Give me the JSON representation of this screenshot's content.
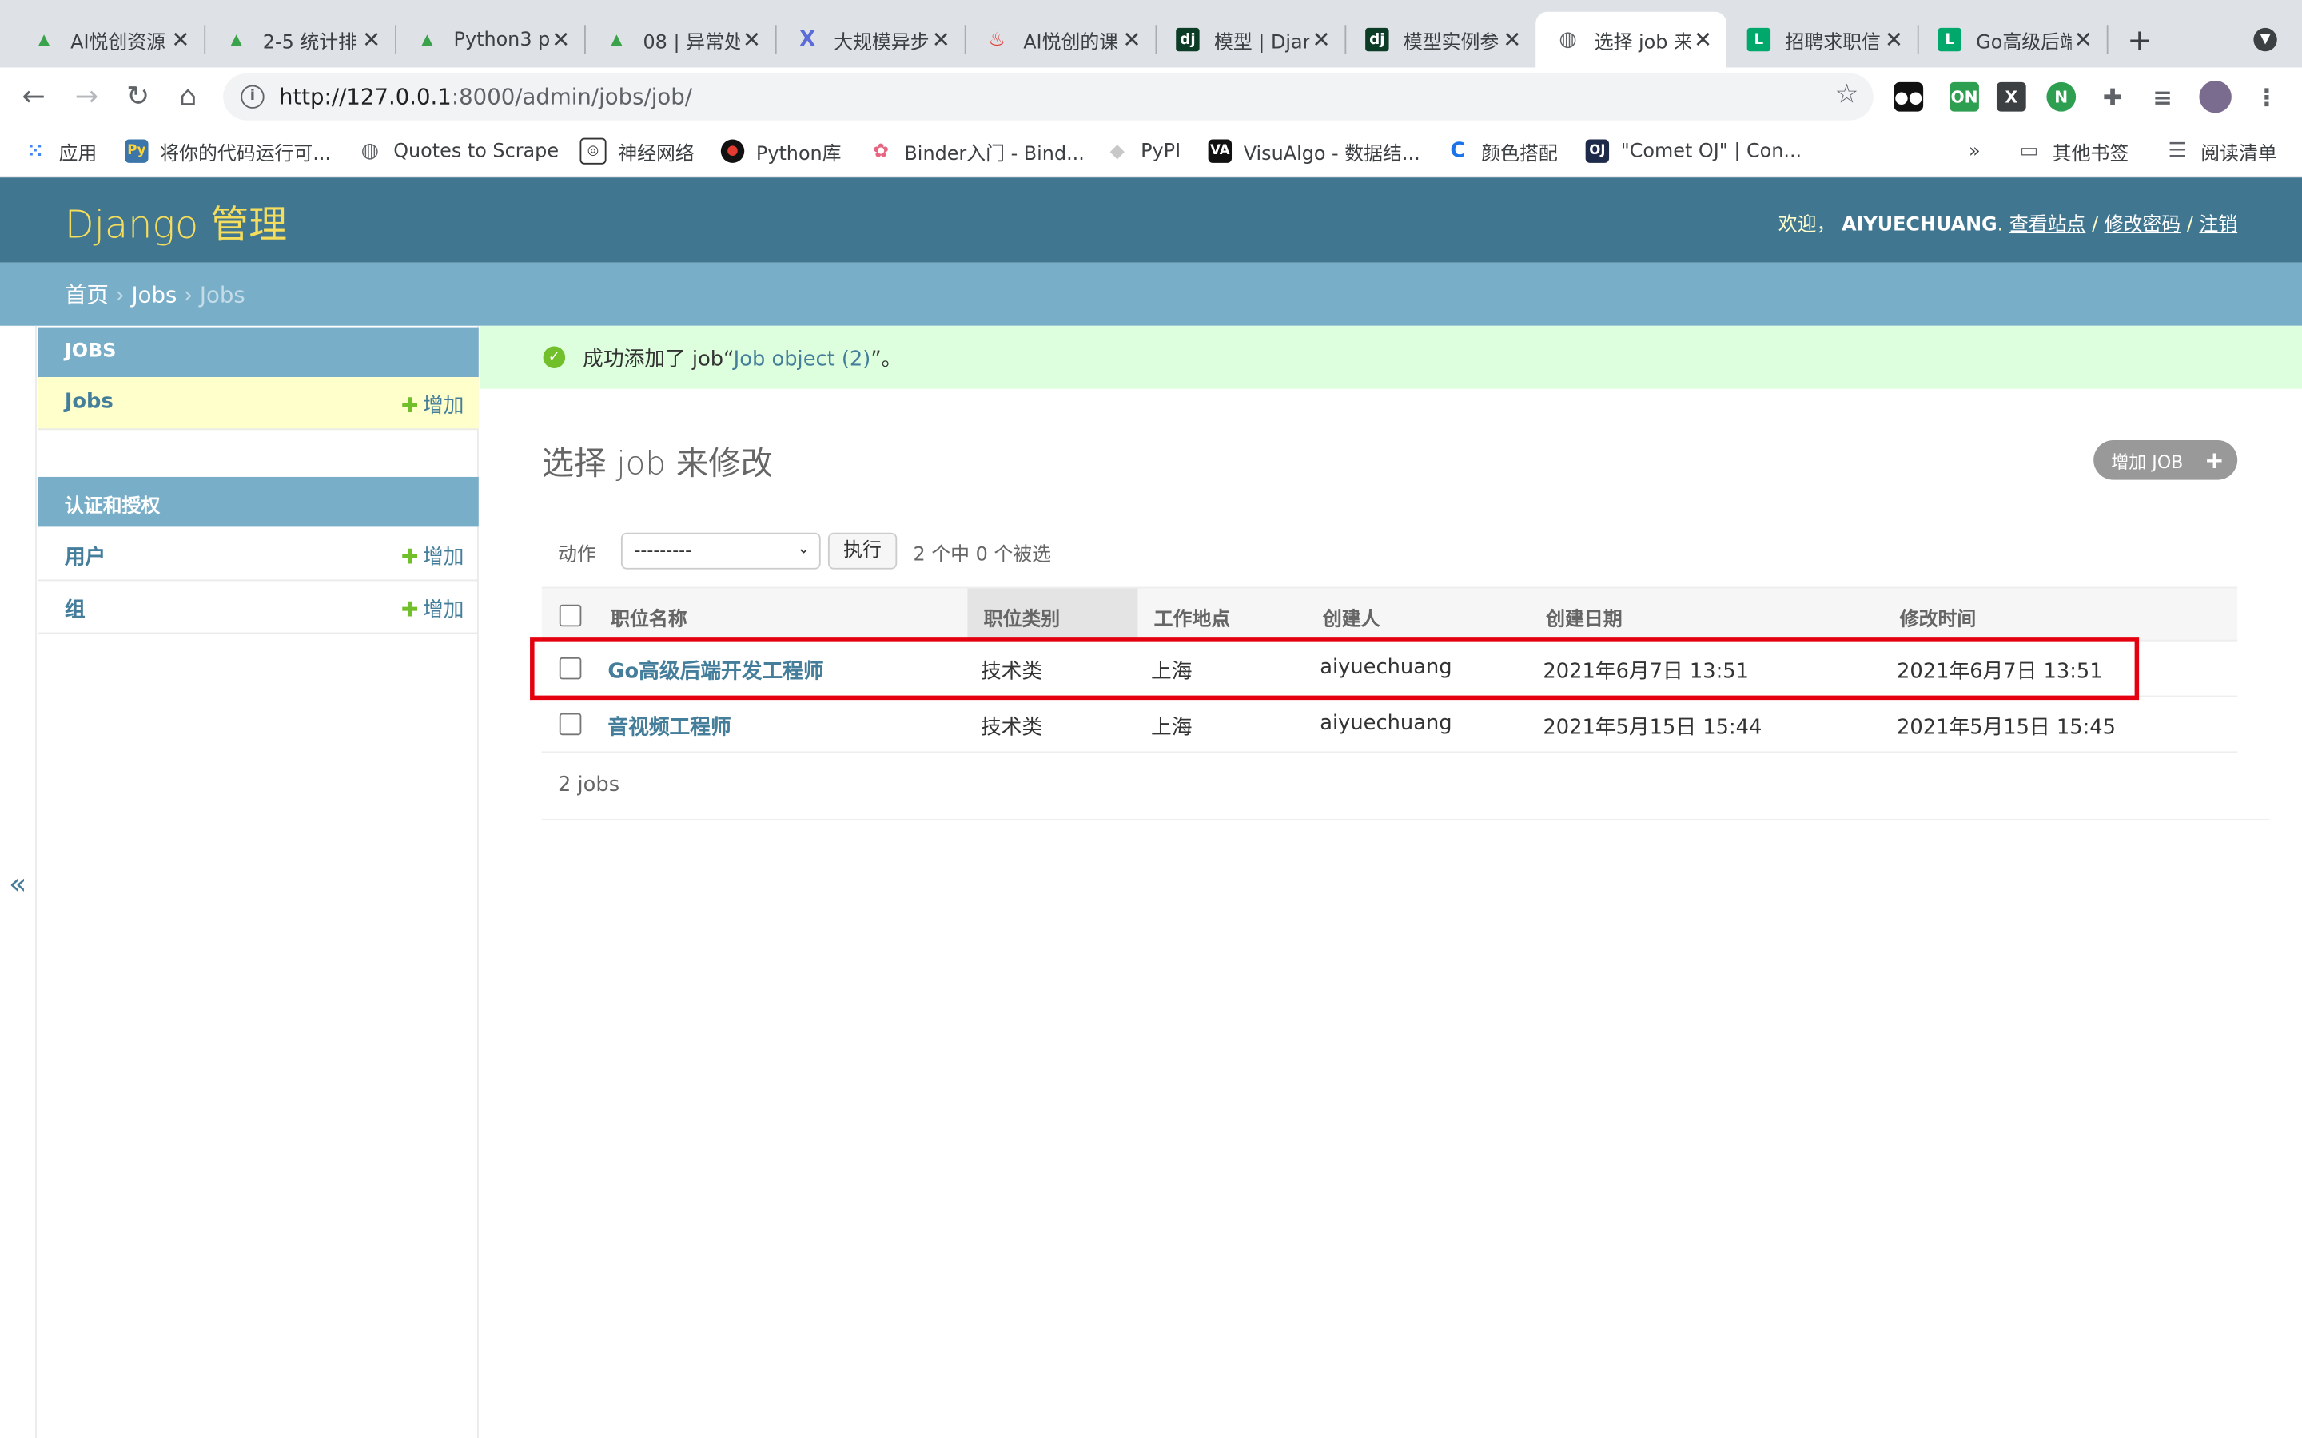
{
  "browser": {
    "tabs": [
      {
        "title": "AI悦创资源",
        "icon": "leaf-icon",
        "color": "#3aa24a"
      },
      {
        "title": "2-5 统计排",
        "icon": "leaf-icon",
        "color": "#3aa24a"
      },
      {
        "title": "Python3 p",
        "icon": "leaf-icon",
        "color": "#3aa24a"
      },
      {
        "title": "08 | 异常处",
        "icon": "leaf-icon",
        "color": "#3aa24a"
      },
      {
        "title": "大规模异步",
        "icon": "x-logo-icon",
        "color": "#5b6bd9"
      },
      {
        "title": "AI悦创的课",
        "icon": "flame-icon",
        "color": "#e23b32"
      },
      {
        "title": "模型 | Djan",
        "icon": "django-icon",
        "color": "#0c3c26"
      },
      {
        "title": "模型实例参",
        "icon": "django-icon",
        "color": "#0c3c26"
      },
      {
        "title": "选择 job 来",
        "icon": "globe-icon",
        "color": "#5f6368"
      },
      {
        "title": "招聘求职信",
        "icon": "l-logo-icon",
        "color": "#00a86b"
      },
      {
        "title": "Go高级后端",
        "icon": "l-logo-icon",
        "color": "#00a86b"
      }
    ],
    "url_host": "http://127.0.0.1",
    "url_path": ":8000/admin/jobs/job/",
    "bookmarks": [
      {
        "label": "应用",
        "icon": "apps-grid-icon"
      },
      {
        "label": "将你的代码运行可...",
        "icon": "python-icon"
      },
      {
        "label": "Quotes to Scrape",
        "icon": "globe-icon"
      },
      {
        "label": "神经网络",
        "icon": "spiral-icon"
      },
      {
        "label": "Python库",
        "icon": "red-dot-icon"
      },
      {
        "label": "Binder入门 - Bind...",
        "icon": "binder-icon"
      },
      {
        "label": "PyPI",
        "icon": "cube-icon"
      },
      {
        "label": "VisuAlgo - 数据结...",
        "icon": "va-icon"
      },
      {
        "label": "颜色搭配",
        "icon": "c-logo-icon"
      },
      {
        "label": "\"Comet OJ\" | Con...",
        "icon": "oj-icon"
      }
    ],
    "bookmarks_more": "»",
    "other_bookmarks": "其他书签",
    "reading_list": "阅读清单"
  },
  "header": {
    "branding": "Django 管理",
    "welcome": "欢迎，",
    "username": "AIYUECHUANG",
    "view_site": "查看站点",
    "change_password": "修改密码",
    "logout": "注销"
  },
  "breadcrumbs": {
    "home": "首页",
    "app": "Jobs",
    "current": "Jobs"
  },
  "sidebar": {
    "modules": [
      {
        "caption": "JOBS",
        "rows": [
          {
            "label": "Jobs",
            "add": "增加",
            "current": true
          }
        ]
      },
      {
        "caption": "认证和授权",
        "rows": [
          {
            "label": "用户",
            "add": "增加"
          },
          {
            "label": "组",
            "add": "增加"
          }
        ]
      }
    ],
    "collapse": "«"
  },
  "message": {
    "prefix": "成功添加了 job“",
    "link": "Job object (2)",
    "suffix": "”。"
  },
  "content": {
    "title": "选择 job 来修改",
    "add_button": "增加 JOB",
    "action_label": "动作",
    "action_select": "---------",
    "go_button": "执行",
    "selection_counter": "2 个中 0 个被选",
    "columns": [
      "职位名称",
      "职位类别",
      "工作地点",
      "创建人",
      "创建日期",
      "修改时间"
    ],
    "rows": [
      [
        "Go高级后端开发工程师",
        "技术类",
        "上海",
        "aiyuechuang",
        "2021年6月7日 13:51",
        "2021年6月7日 13:51"
      ],
      [
        "音视频工程师",
        "技术类",
        "上海",
        "aiyuechuang",
        "2021年5月15日 15:44",
        "2021年5月15日 15:45"
      ]
    ],
    "paginator": "2 jobs"
  },
  "colors": {
    "header": "#417690",
    "branding": "#f5dd5d",
    "breadcrumbs": "#79aec8",
    "link": "#447e9b",
    "highlight": "#e5000f",
    "success": "#dfd"
  }
}
